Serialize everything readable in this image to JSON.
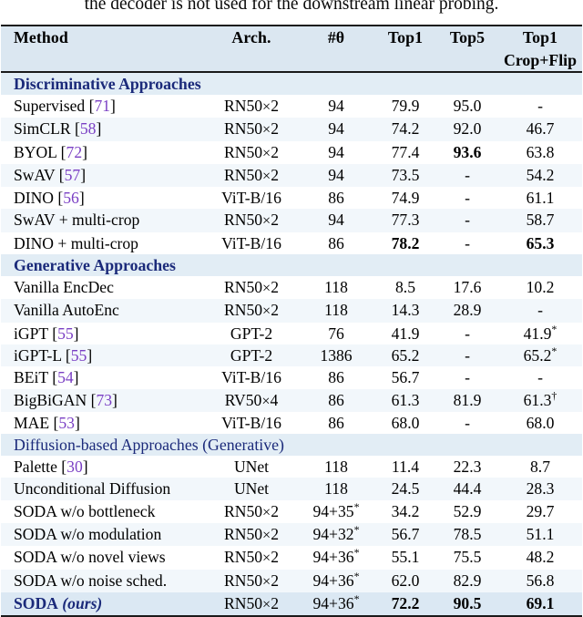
{
  "caption_tail": "the decoder is not used for the downstream linear probing.",
  "table": {
    "columns": [
      {
        "key": "method",
        "label": "Method",
        "sub": ""
      },
      {
        "key": "arch",
        "label": "Arch.",
        "sub": ""
      },
      {
        "key": "theta",
        "label": "#θ",
        "sub": ""
      },
      {
        "key": "top1",
        "label": "Top1",
        "sub": ""
      },
      {
        "key": "top5",
        "label": "Top5",
        "sub": ""
      },
      {
        "key": "cropflip",
        "label": "Top1",
        "sub": "Crop+Flip"
      }
    ],
    "sections": [
      {
        "title": "Discriminative Approaches",
        "title_bold": true,
        "rows": [
          {
            "method": "Supervised",
            "cite": "71",
            "arch": "RN50×2",
            "theta": "94",
            "top1": "79.9",
            "top5": "95.0",
            "cropflip": "-",
            "bold": []
          },
          {
            "method": "SimCLR",
            "cite": "58",
            "arch": "RN50×2",
            "theta": "94",
            "top1": "74.2",
            "top5": "92.0",
            "cropflip": "46.7",
            "bold": []
          },
          {
            "method": "BYOL",
            "cite": "72",
            "arch": "RN50×2",
            "theta": "94",
            "top1": "77.4",
            "top5": "93.6",
            "cropflip": "63.8",
            "bold": [
              "top5"
            ]
          },
          {
            "method": "SwAV",
            "cite": "57",
            "arch": "RN50×2",
            "theta": "94",
            "top1": "73.5",
            "top5": "-",
            "cropflip": "54.2",
            "bold": []
          },
          {
            "method": "DINO",
            "cite": "56",
            "arch": "ViT-B/16",
            "theta": "86",
            "top1": "74.9",
            "top5": "-",
            "cropflip": "61.1",
            "bold": []
          },
          {
            "method": "SwAV + multi-crop",
            "cite": "",
            "arch": "RN50×2",
            "theta": "94",
            "top1": "77.3",
            "top5": "-",
            "cropflip": "58.7",
            "bold": []
          },
          {
            "method": "DINO + multi-crop",
            "cite": "",
            "arch": "ViT-B/16",
            "theta": "86",
            "top1": "78.2",
            "top5": "-",
            "cropflip": "65.3",
            "bold": [
              "top1",
              "cropflip"
            ]
          }
        ]
      },
      {
        "title": "Generative Approaches",
        "title_bold": true,
        "rows": [
          {
            "method": "Vanilla EncDec",
            "cite": "",
            "arch": "RN50×2",
            "theta": "118",
            "top1": "8.5",
            "top5": "17.6",
            "cropflip": "10.2",
            "bold": []
          },
          {
            "method": "Vanilla AutoEnc",
            "cite": "",
            "arch": "RN50×2",
            "theta": "118",
            "top1": "14.3",
            "top5": "28.9",
            "cropflip": "-",
            "bold": []
          },
          {
            "method": "iGPT",
            "cite": "55",
            "arch": "GPT-2",
            "theta": "76",
            "top1": "41.9",
            "top5": "-",
            "cropflip": "41.9",
            "cropflip_mark": "*",
            "bold": []
          },
          {
            "method": "iGPT-L",
            "cite": "55",
            "arch": "GPT-2",
            "theta": "1386",
            "top1": "65.2",
            "top5": "-",
            "cropflip": "65.2",
            "cropflip_mark": "*",
            "bold": []
          },
          {
            "method": "BEiT",
            "cite": "54",
            "arch": "ViT-B/16",
            "theta": "86",
            "top1": "56.7",
            "top5": "-",
            "cropflip": "-",
            "bold": []
          },
          {
            "method": "BigBiGAN",
            "cite": "73",
            "arch": "RV50×4",
            "theta": "86",
            "top1": "61.3",
            "top5": "81.9",
            "cropflip": "61.3",
            "cropflip_mark": "†",
            "bold": []
          },
          {
            "method": "MAE",
            "cite": "53",
            "arch": "ViT-B/16",
            "theta": "86",
            "top1": "68.0",
            "top5": "-",
            "cropflip": "68.0",
            "bold": []
          }
        ]
      },
      {
        "title": "Diffusion-based Approaches (Generative)",
        "title_bold": false,
        "rows": [
          {
            "method": "Palette",
            "cite": "30",
            "arch": "UNet",
            "theta": "118",
            "top1": "11.4",
            "top5": "22.3",
            "cropflip": "8.7",
            "bold": []
          },
          {
            "method": "Unconditional Diffusion",
            "cite": "",
            "arch": "UNet",
            "theta": "118",
            "top1": "24.5",
            "top5": "44.4",
            "cropflip": "28.3",
            "bold": []
          },
          {
            "method": "SODA w/o bottleneck",
            "cite": "",
            "arch": "RN50×2",
            "theta": "94+35",
            "theta_mark": "*",
            "top1": "34.2",
            "top5": "52.9",
            "cropflip": "29.7",
            "bold": []
          },
          {
            "method": "SODA w/o modulation",
            "cite": "",
            "arch": "RN50×2",
            "theta": "94+32",
            "theta_mark": "*",
            "top1": "56.7",
            "top5": "78.5",
            "cropflip": "51.1",
            "bold": []
          },
          {
            "method": "SODA w/o novel views",
            "cite": "",
            "arch": "RN50×2",
            "theta": "94+36",
            "theta_mark": "*",
            "top1": "55.1",
            "top5": "75.5",
            "cropflip": "48.2",
            "bold": []
          },
          {
            "method": "SODA w/o noise sched.",
            "cite": "",
            "arch": "RN50×2",
            "theta": "94+36",
            "theta_mark": "*",
            "top1": "62.0",
            "top5": "82.9",
            "cropflip": "56.8",
            "bold": []
          },
          {
            "method": "SODA",
            "method_suffix": "(ours)",
            "highlight": true,
            "cite": "",
            "arch": "RN50×2",
            "theta": "94+36",
            "theta_mark": "*",
            "top1": "72.2",
            "top5": "90.5",
            "cropflip": "69.1",
            "bold": [
              "top1",
              "top5",
              "cropflip"
            ]
          }
        ]
      }
    ]
  },
  "colors": {
    "header_band": "#dbe7f1",
    "section_band": "#e2edf5",
    "row_shade": "#f2f7fb",
    "highlight_row": "#dbe8f3",
    "section_text": "#1b2a7a",
    "citation": "#7a3fc4",
    "rule": "#1a1a1a"
  }
}
